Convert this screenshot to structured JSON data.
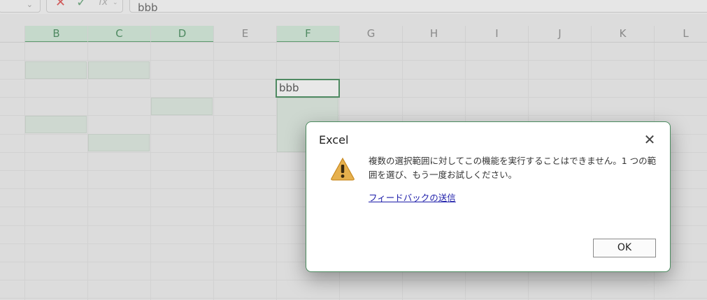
{
  "formula_bar": {
    "value": "bbb",
    "cancel_icon": "close-icon",
    "enter_icon": "check-icon",
    "function_icon": "fx-icon"
  },
  "columns": [
    "B",
    "C",
    "D",
    "E",
    "F",
    "G",
    "H",
    "I",
    "J",
    "K",
    "L"
  ],
  "selected_columns": [
    "B",
    "C",
    "D",
    "F"
  ],
  "active_cell": {
    "column": "F",
    "value": "bbb"
  },
  "dialog": {
    "title": "Excel",
    "message": "複数の選択範囲に対してこの機能を実行することはできません。1 つの範囲を選び、もう一度お試しください。",
    "feedback_link": "フィードバックの送信",
    "ok_label": "OK",
    "icon": "warning-icon"
  },
  "colors": {
    "accent_green": "#4f8a62",
    "selection_fill": "#ced8d0",
    "warning_yellow": "#e0a83a",
    "link_blue": "#1a1aa8"
  }
}
